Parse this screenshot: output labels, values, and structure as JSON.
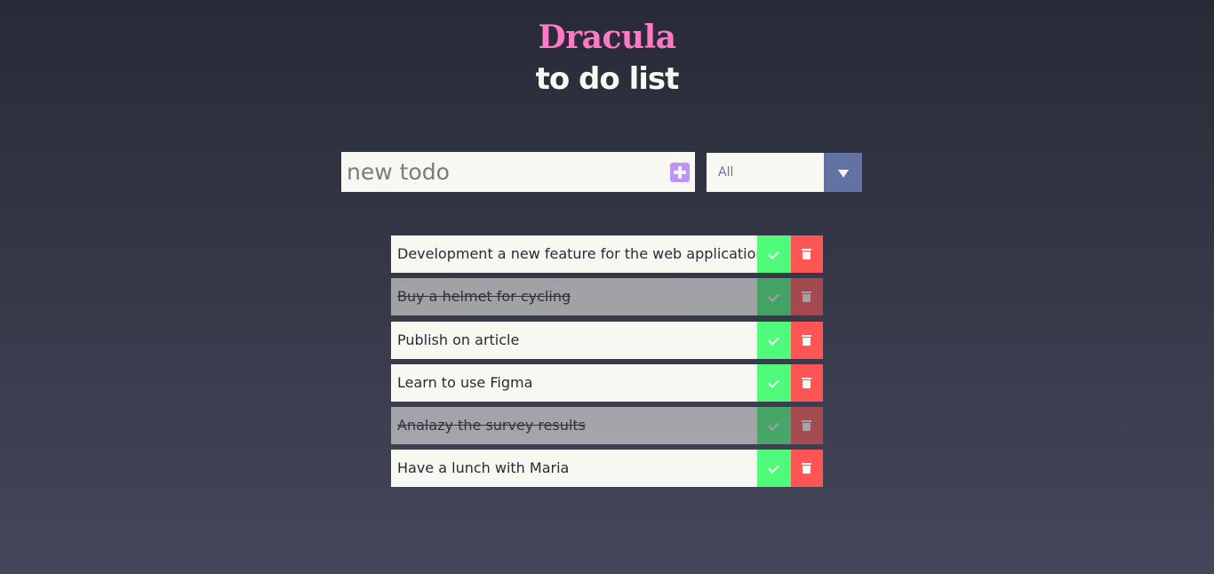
{
  "header": {
    "brand": "Dracula",
    "subtitle": "to do list"
  },
  "form": {
    "input_placeholder": "new todo",
    "add_icon": "plus-square-icon"
  },
  "filter": {
    "selected": "All",
    "arrow_icon": "caret-down-icon"
  },
  "todos": [
    {
      "text": "Development a new feature for the web application",
      "completed": false
    },
    {
      "text": "Buy a helmet for cycling",
      "completed": true
    },
    {
      "text": "Publish on article",
      "completed": false
    },
    {
      "text": "Learn to use Figma",
      "completed": false
    },
    {
      "text": "Analazy the survey results",
      "completed": true
    },
    {
      "text": "Have a lunch with Maria",
      "completed": false
    }
  ],
  "icons": {
    "complete": "check-icon",
    "delete": "trash-icon"
  },
  "colors": {
    "brand": "#ff79c6",
    "accent_purple": "#bd93f9",
    "select_accent": "#6272a4",
    "complete": "#50fa7b",
    "delete": "#ff5555",
    "item_background": "#f8f8f2",
    "background_top": "#282a36",
    "background_bottom": "#44475a"
  }
}
